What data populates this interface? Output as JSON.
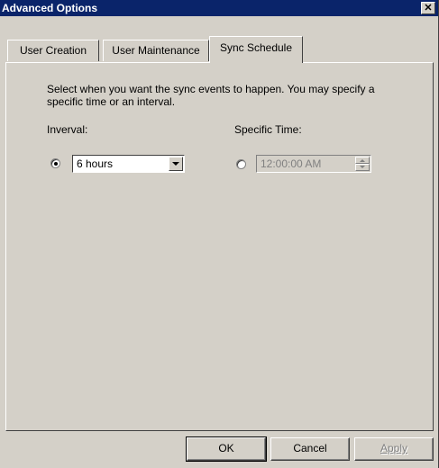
{
  "window": {
    "title": "Advanced Options",
    "close_glyph": "✕"
  },
  "tabs": [
    {
      "label": "User Creation",
      "active": false
    },
    {
      "label": "User Maintenance",
      "active": false
    },
    {
      "label": "Sync Schedule",
      "active": true
    }
  ],
  "sync_schedule": {
    "description": "Select when you want the sync events to happen. You may specify a specific time or an interval.",
    "interval": {
      "label": "Inverval:",
      "selected": true,
      "value": "6 hours"
    },
    "specific_time": {
      "label": "Specific Time:",
      "selected": false,
      "value": "12:00:00 AM",
      "enabled": false
    }
  },
  "buttons": {
    "ok": "OK",
    "cancel": "Cancel",
    "apply": "Apply"
  },
  "colors": {
    "titlebar": "#0a246a",
    "face": "#d4d0c8"
  }
}
